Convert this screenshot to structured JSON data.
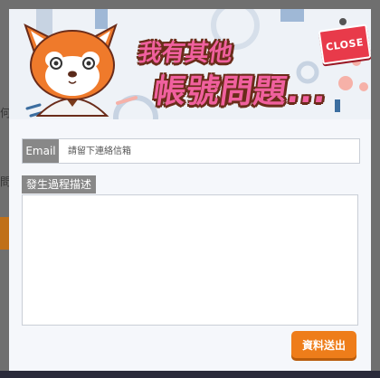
{
  "banner": {
    "title_line1": "我有其他",
    "title_line2": "帳號問題...",
    "close_label": "CLOSE",
    "mascot": "red-panda-mascot"
  },
  "background_page": {
    "partial_char_1": "何",
    "partial_char_2": "問"
  },
  "form": {
    "email_label": "Email",
    "email_placeholder": "請留下連絡信箱",
    "email_value": "",
    "description_label": "發生過程描述",
    "description_value": "",
    "submit_label": "資料送出"
  },
  "colors": {
    "accent_orange": "#ee7d1a",
    "close_red": "#e83a4a",
    "title_pink": "#f0609e",
    "label_gray": "#888888"
  }
}
